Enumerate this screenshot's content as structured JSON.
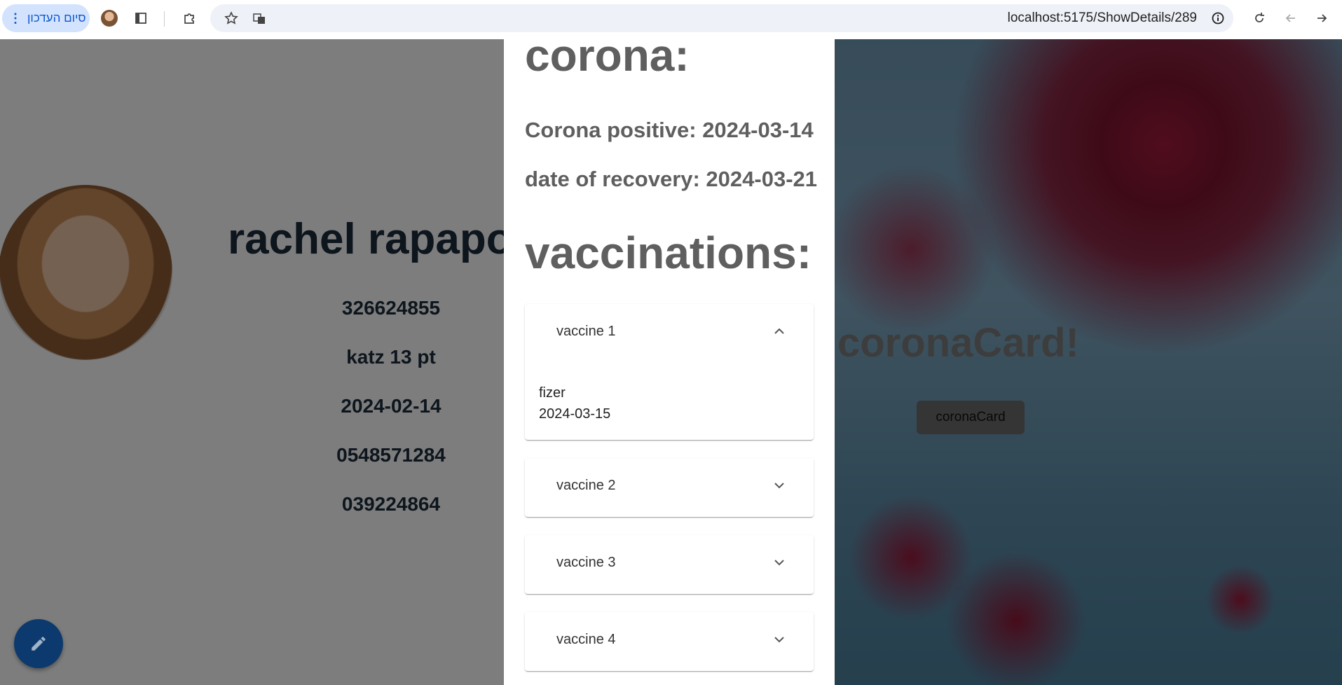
{
  "browser": {
    "update_label": "סיום העדכון",
    "url": "localhost:5175/ShowDetails/289"
  },
  "profile": {
    "name": "rachel rapaport",
    "id_number": "326624855",
    "address": "katz 13 pt",
    "date": "2024-02-14",
    "mobile": "0548571284",
    "phone": "039224864"
  },
  "corona_card": {
    "title": "coronaCard!",
    "button_label": "coronaCard"
  },
  "drawer": {
    "corona_heading": "corona:",
    "positive_line": "Corona positive: 2024-03-14",
    "recovery_line": "date of recovery: 2024-03-21",
    "vaccinations_heading": "vaccinations:",
    "vaccines": [
      {
        "title": "vaccine 1",
        "expanded": true,
        "manufacturer": "fizer",
        "date": "2024-03-15"
      },
      {
        "title": "vaccine 2",
        "expanded": false
      },
      {
        "title": "vaccine 3",
        "expanded": false
      },
      {
        "title": "vaccine 4",
        "expanded": false
      }
    ]
  },
  "colors": {
    "fab": "#1565c0",
    "heading_gray": "#5f5f5f",
    "name_navy": "#1b2a3a"
  },
  "icons": {
    "fab": "pencil-icon",
    "accordion_expanded": "chevron-up-icon",
    "accordion_collapsed": "chevron-down-icon"
  }
}
